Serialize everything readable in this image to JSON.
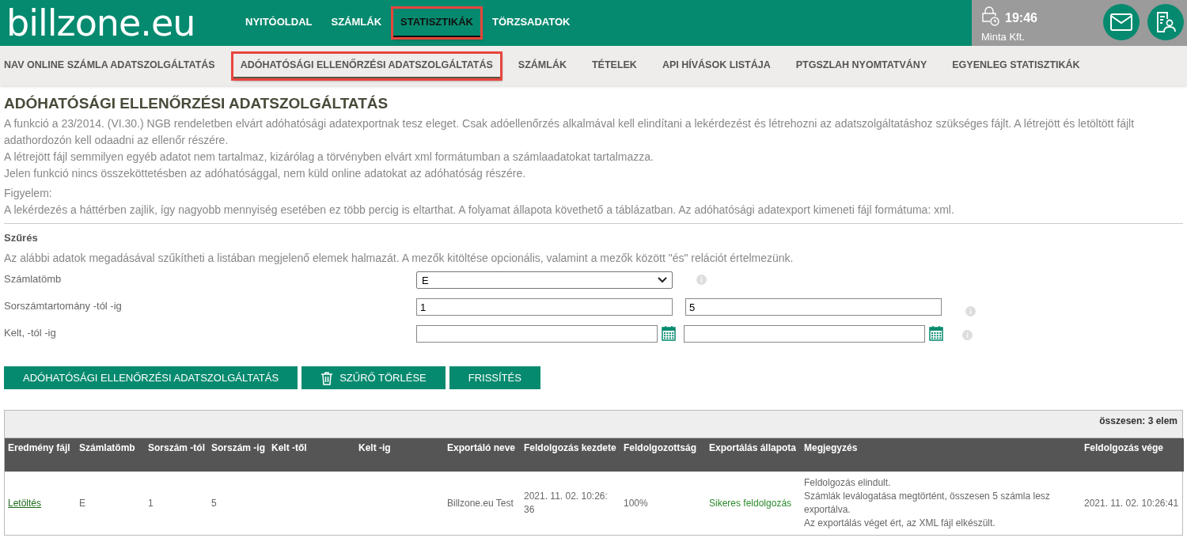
{
  "header": {
    "logo": "billzone.eu",
    "nav": [
      {
        "label": "NYITÓOLDAL",
        "selected": false,
        "highlighted": false
      },
      {
        "label": "SZÁMLÁK",
        "selected": false,
        "highlighted": false
      },
      {
        "label": "STATISZTIKÁK",
        "selected": true,
        "highlighted": true
      },
      {
        "label": "TÖRZSADATOK",
        "selected": false,
        "highlighted": false
      }
    ],
    "session": {
      "time": "19:46",
      "company": "Minta Kft."
    }
  },
  "subnav": [
    {
      "label": "NAV ONLINE SZÁMLA ADATSZOLGÁLTATÁS",
      "selected": false,
      "highlighted": false
    },
    {
      "label": "ADÓHATÓSÁGI ELLENŐRZÉSI ADATSZOLGÁLTATÁS",
      "selected": true,
      "highlighted": true
    },
    {
      "label": "SZÁMLÁK",
      "selected": false,
      "highlighted": false
    },
    {
      "label": "TÉTELEK",
      "selected": false,
      "highlighted": false
    },
    {
      "label": "API HÍVÁSOK LISTÁJA",
      "selected": false,
      "highlighted": false
    },
    {
      "label": "PTGSZLAH NYOMTATVÁNY",
      "selected": false,
      "highlighted": false
    },
    {
      "label": "EGYENLEG STATISZTIKÁK",
      "selected": false,
      "highlighted": false
    }
  ],
  "page": {
    "title": "ADÓHATÓSÁGI ELLENŐRZÉSI ADATSZOLGÁLTATÁS",
    "paragraphs": [
      "A funkció a 23/2014. (VI.30.) NGB rendeletben elvárt adóhatósági adatexportnak tesz eleget. Csak adóellenőrzés alkalmával kell elindítani a lekérdezést és létrehozni az adatszolgáltatáshoz szükséges fájlt. A létrejött és letöltött fájlt adathordozón kell odaadni az ellenőr részére.",
      "A létrejött fájl semmilyen egyéb adatot nem tartalmaz, kizárólag a törvényben elvárt xml formátumban a számlaadatokat tartalmazza.",
      "Jelen funkció nincs összeköttetésben az adóhatósággal, nem küld online adatokat az adóhatóság részére."
    ],
    "notice_label": "Figyelem:",
    "notice": "A lekérdezés a háttérben zajlik, így nagyobb mennyiség esetében ez több percig is eltarthat. A folyamat állapota követhető a táblázatban. Az adóhatósági adatexport kimeneti fájl formátuma: xml."
  },
  "filter": {
    "title": "Szűrés",
    "description": "Az alábbi adatok megadásával szűkítheti a listában megjelenő elemek halmazát. A mezők kitöltése opcionális, valamint a mezők között \"és\" relációt értelmezünk.",
    "fields": [
      {
        "kind": "select",
        "label": "Számlatömb",
        "value": "E"
      },
      {
        "kind": "range",
        "label": "Sorszámtartomány -tól -ig",
        "from": "1",
        "to": "5"
      },
      {
        "kind": "daterange",
        "label": "Kelt, -tól -ig"
      }
    ]
  },
  "buttons": [
    {
      "kind": "plain",
      "label": "ADÓHATÓSÁGI ELLENŐRZÉSI ADATSZOLGÁLTATÁS"
    },
    {
      "kind": "trash",
      "label": "SZŰRŐ TÖRLÉSE"
    },
    {
      "kind": "plain",
      "label": "FRISSÍTÉS"
    }
  ],
  "table": {
    "summary": "összesen: 3 elem",
    "columns": [
      "Eredmény fájl",
      "Számlatömb",
      "Sorszám -tól",
      "Sorszám -ig",
      "Kelt -től",
      "Kelt -ig",
      "Exportáló neve",
      "Feldolgozás kezdete",
      "Feldolgozottság",
      "Exportálás állapota",
      "Megjegyzés",
      "Feldolgozás vége"
    ],
    "rows": [
      {
        "cells": [
          {
            "kind": "link",
            "text": "Letöltés"
          },
          {
            "kind": "text",
            "text": "E"
          },
          {
            "kind": "text",
            "text": "1"
          },
          {
            "kind": "text",
            "text": "5"
          },
          {
            "kind": "text",
            "text": ""
          },
          {
            "kind": "text",
            "text": ""
          },
          {
            "kind": "text",
            "text": "Billzone.eu Test"
          },
          {
            "kind": "text",
            "text": "2021. 11. 02. 10:26: 36"
          },
          {
            "kind": "text",
            "text": "100%"
          },
          {
            "kind": "status",
            "text": "Sikeres feldolgozás"
          },
          {
            "kind": "lines",
            "lines": [
              "Feldolgozás elindult.",
              "Számlák leválogatása megtörtént, összesen 5 számla lesz exportálva.",
              "Az exportálás véget ért, az XML fájl elkészült."
            ]
          },
          {
            "kind": "text",
            "text": "2021. 11. 02. 10:26:41"
          }
        ]
      }
    ]
  }
}
